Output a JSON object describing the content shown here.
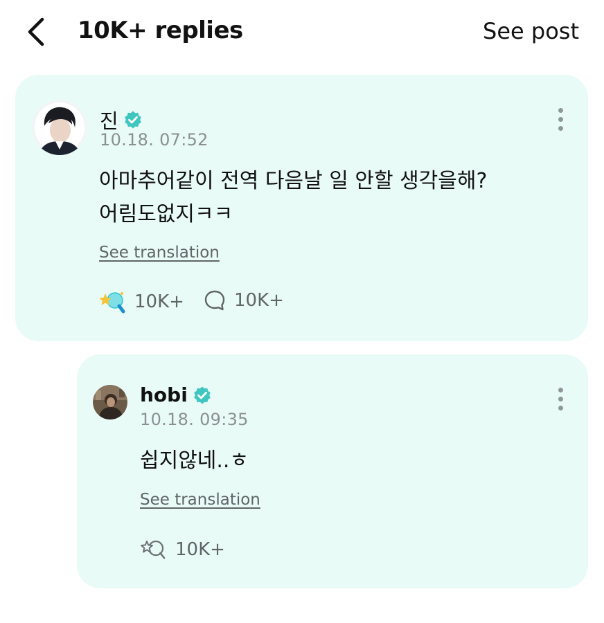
{
  "header": {
    "back_icon": "chevron-left-icon",
    "title": "10K+ replies",
    "see_post_label": "See post"
  },
  "colors": {
    "card_background": "#e9fbf6",
    "verified_badge": "#3fc6c0",
    "muted_text": "#8a8f94"
  },
  "post": {
    "author": "진",
    "verified": true,
    "timestamp": "10.18. 07:52",
    "text": "아마추어같이 전역 다음날 일 안할 생각을해?\n어림도없지ㅋㅋ",
    "translation_label": "See translation",
    "like_icon": "sparkle-reaction-icon",
    "like_count": "10K+",
    "comment_icon": "comment-bubble-icon",
    "comment_count": "10K+",
    "more_icon": "more-vertical-icon"
  },
  "reply": {
    "author": "hobi",
    "verified": true,
    "timestamp": "10.18. 09:35",
    "text": "쉽지않네..ㅎ",
    "translation_label": "See translation",
    "like_icon": "reaction-outline-icon",
    "like_count": "10K+",
    "more_icon": "more-vertical-icon"
  }
}
